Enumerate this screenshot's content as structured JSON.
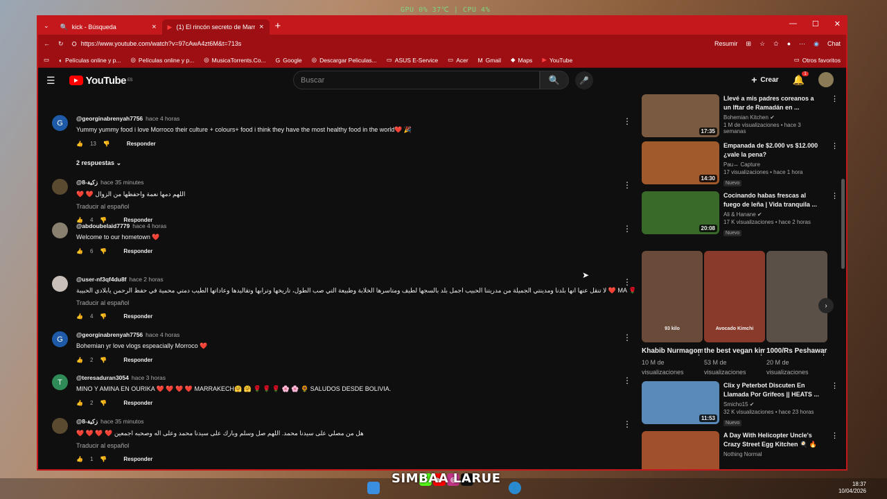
{
  "overlay": {
    "gpu": "GPU 0% 37℃ | CPU 4%",
    "streamer": "SIMBAA LARUE"
  },
  "browser": {
    "tabs": [
      {
        "title": "kick - Búsqueda"
      },
      {
        "title": "(1) El rincón secreto de Marrakech"
      }
    ],
    "url": "https://www.youtube.com/watch?v=97cAwA4zt6M&t=713s",
    "summarize_label": "Resumir",
    "chat_label": "Chat",
    "bookmarks": [
      "Películas online y p...",
      "Películas online y p...",
      "MusicaTorrents.Co...",
      "Google",
      "Descargar Peliculas...",
      "ASUS E-Service",
      "Acer",
      "Gmail",
      "Maps",
      "YouTube"
    ],
    "other_favorites": "Otros favoritos"
  },
  "youtube": {
    "logo": "YouTube",
    "region": "ES",
    "search_placeholder": "Buscar",
    "create_label": "Crear",
    "notif_count": "1"
  },
  "comments": [
    {
      "initial": "G",
      "author": "@georginabrenyah7756",
      "time": "hace 4 horas",
      "text": "Yummy yummy food i love Morroco their culture + colours+ food i think they have the most healthy food in the world❤️ 🎉",
      "likes": "13",
      "reply": "Responder",
      "replies": "2 respuestas",
      "color": "#1e5aa8"
    },
    {
      "initial": "",
      "author": "@زكية-8",
      "time": "hace 35 minutes",
      "text": "❤️ ❤️ اللهم دمها نعمة واحفظها من الزوال",
      "translate": "Traducir al español",
      "likes": "4",
      "reply": "Responder",
      "color": "#5a4a30"
    },
    {
      "initial": "",
      "author": "@abdoubelaid7779",
      "time": "hace 4 horas",
      "text": "Welcome to our hometown ❤️",
      "likes": "6",
      "reply": "Responder",
      "color": "#8a8070"
    },
    {
      "initial": "",
      "author": "@user-nf3qf4du8f",
      "time": "hace 2 horas",
      "text": "لا تنقل عنها انها بلدنا ومدينتي الجميلة من مدريتنا الحبيب اجمل بلد بالسجها لطيف ومتاسرها الخلابة وطبيعة التي صب الطول، تاريخها وترابها وتقاليدها وعاداتها الطيب دمتي محمية في حفظ الرحمن يابلادي الحبيبة ❤️ MA 🌹",
      "translate": "Traducir al español",
      "likes": "4",
      "reply": "Responder",
      "color": "#c8c0b8"
    },
    {
      "initial": "G",
      "author": "@georginabrenyah7756",
      "time": "hace 4 horas",
      "text": "Bohemian yr love vlogs espeacially Morroco ❤️",
      "likes": "2",
      "reply": "Responder",
      "color": "#1e5aa8"
    },
    {
      "initial": "T",
      "author": "@teresaduran3054",
      "time": "hace 3 horas",
      "text": "MINO Y AMINA EN OURIKA ❤️ ❤️ ❤️ ❤️ MARRAKECH🤗 🤗 🌹 🌹 🌹 🌸 🌸 🌻 SALUDOS DESDE BOLIVIA.",
      "likes": "2",
      "reply": "Responder",
      "color": "#2e8b57"
    },
    {
      "initial": "",
      "author": "@زكية-8",
      "time": "hace 35 minutos",
      "text": "❤️ ❤️ ❤️ ❤️ هل من مصلي على سيدنا محمد.   اللهم صل وسلم وبارك على سيدنا محمد وعلى اله وصحبه اجمعين",
      "translate": "Traducir al español",
      "likes": "1",
      "reply": "Responder",
      "color": "#5a4a30"
    }
  ],
  "videos": [
    {
      "title": "Llevé a mis padres coreanos a un Iftar de Ramadán en ...",
      "channel": "Bohemian Kitchen ✔",
      "meta": "1 M de visualizaciones • hace 3 semanas",
      "duration": "17:35",
      "color": "#7a5a40"
    },
    {
      "title": "Empanada de $2.000 vs $12.000 ¿vale la pena?",
      "channel": "Pau↔ Capture",
      "meta": "17 visualizaciones • hace 1 hora",
      "badge": "Nuevo",
      "duration": "14:30",
      "color": "#a05a2c"
    },
    {
      "title": "Cocinando habas frescas al fuego de leña | Vida tranquila ...",
      "channel": "Ali & Hanane ✔",
      "meta": "17 K visualizaciones • hace 2 horas",
      "badge": "Nuevo",
      "duration": "20:08",
      "color": "#3a6a2a"
    },
    {
      "title": "Clix y Peterbot Discuten En Llamada Por Grifeos || HEATS ...",
      "channel": "Smicho15 ✔",
      "meta": "32 K visualizaciones • hace 23 horas",
      "badge": "Nuevo",
      "duration": "11:53",
      "color": "#5a8ab8"
    },
    {
      "title": "A Day With Helicopter Uncle's Crazy Street Egg Kitchen 🍳 🔥",
      "channel": "Nothing Normal",
      "meta": "",
      "duration": "",
      "color": "#a0502a"
    }
  ],
  "shorts": [
    {
      "title": "Khabib Nurmagom...",
      "views": "10 M de visualizaciones",
      "overlay": "93 kilo",
      "color": "#6a4a38"
    },
    {
      "title": "the best vegan kimc...",
      "views": "53 M de visualizaciones",
      "overlay": "Avocado Kimchi",
      "color": "#8a3a2a"
    },
    {
      "title": "1000/Rs Peshawari ...",
      "views": "20 M de visualizaciones",
      "overlay": "",
      "color": "#5a5048"
    }
  ],
  "clock": {
    "time": "18:37",
    "date": "10/04/2026"
  }
}
